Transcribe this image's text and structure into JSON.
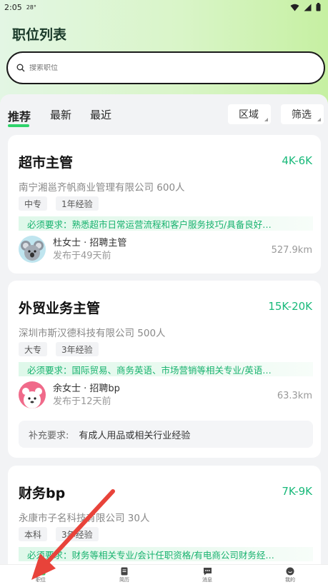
{
  "status_bar": {
    "time": "2:05",
    "temp": "28°"
  },
  "page": {
    "title": "职位列表"
  },
  "search": {
    "placeholder": "搜索职位"
  },
  "tabs": [
    {
      "label": "推荐"
    },
    {
      "label": "最新"
    },
    {
      "label": "最近"
    }
  ],
  "filters": {
    "area": "区域",
    "filter": "筛选"
  },
  "jobs": [
    {
      "title": "超市主管",
      "salary": "4K-6K",
      "company": "南宁湘邕齐帆商业管理有限公司 600人",
      "tags": [
        "中专",
        "1年经验"
      ],
      "requirement": "必须要求：熟悉超市日常运营流程和客户服务技巧/具备良好…",
      "recruiter": "杜女士 · 招聘主管",
      "posted": "发布于49天前",
      "distance": "527.9km",
      "avatar": "koala-avatar"
    },
    {
      "title": "外贸业务主管",
      "salary": "15K-20K",
      "company": "深圳市斯汉德科技有限公司 500人",
      "tags": [
        "大专",
        "3年经验"
      ],
      "requirement": "必须要求：国际贸易、商务英语、市场营销等相关专业/英语…",
      "recruiter": "余女士 · 招聘bp",
      "posted": "发布于12天前",
      "distance": "63.3km",
      "avatar": "llama-avatar",
      "supplement_label": "补充要求:",
      "supplement": "有成人用品或相关行业经验"
    },
    {
      "title": "财务bp",
      "salary": "7K-9K",
      "company": "永康市子名科技有限公司 30人",
      "tags": [
        "本科",
        "3年经验"
      ],
      "requirement": "必须要求：财务等相关专业/会计任职资格/有电商公司财务经…"
    }
  ],
  "bottom_nav": [
    {
      "label": "职位",
      "icon": "briefcase-icon",
      "active": true
    },
    {
      "label": "简历",
      "icon": "resume-icon"
    },
    {
      "label": "消息",
      "icon": "message-icon"
    },
    {
      "label": "我的",
      "icon": "profile-icon"
    }
  ],
  "colors": {
    "accent": "#19b97a",
    "tab_underline": "#2fd36b",
    "arrow": "#e8433a"
  }
}
